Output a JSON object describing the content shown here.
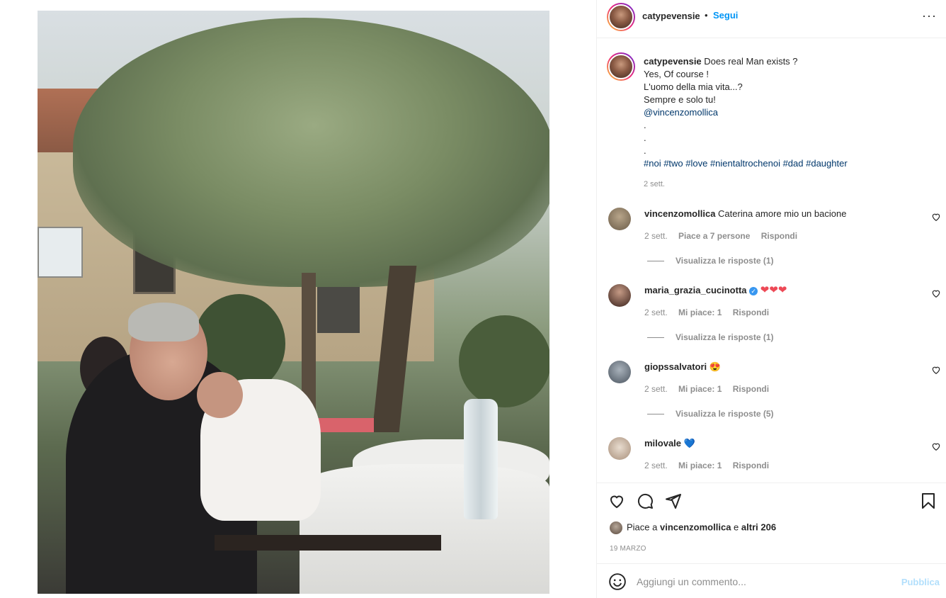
{
  "post": {
    "author": "catypevensie",
    "follow_label": "Segui",
    "separator": "•",
    "more_label": "···"
  },
  "caption": {
    "username": "catypevensie",
    "lines": [
      "Does real Man exists ?",
      "Yes, Of course !",
      "L'uomo della mia vita...?",
      "Sempre e solo tu!",
      "@vincenzomollica",
      ".",
      ".",
      ".",
      "#noi #two #love #nientaltrochenoi #dad #daughter"
    ],
    "time": "2 sett."
  },
  "comments": [
    {
      "username": "vincenzomollica",
      "text": "Caterina amore mio un bacione",
      "time": "2 sett.",
      "likes": "Piace a 7 persone",
      "reply": "Rispondi",
      "view_replies": "Visualizza le risposte (1)",
      "avatar_color": "#8a7a62"
    },
    {
      "username": "maria_grazia_cucinotta",
      "verified": true,
      "text": "❤❤❤",
      "time": "2 sett.",
      "likes": "Mi piace: 1",
      "reply": "Rispondi",
      "view_replies": "Visualizza le risposte (1)",
      "avatar_color": "#4a2f28"
    },
    {
      "username": "giopssalvatori",
      "text": "😍",
      "time": "2 sett.",
      "likes": "Mi piace: 1",
      "reply": "Rispondi",
      "view_replies": "Visualizza le risposte (5)",
      "avatar_color": "#6f7a86"
    },
    {
      "username": "milovale",
      "text": "💙",
      "time": "2 sett.",
      "likes": "Mi piace: 1",
      "reply": "Rispondi",
      "avatar_color": "#c9b8a8"
    }
  ],
  "likes": {
    "prefix": "Piace a",
    "user": "vincenzomollica",
    "suffix_and": "e",
    "others": "altri 206"
  },
  "date": "19 MARZO",
  "composer": {
    "placeholder": "Aggiungi un commento...",
    "publish_label": "Pubblica"
  },
  "colors": {
    "link_blue": "#0095f6",
    "hashtag_blue": "#00376b",
    "publish_disabled": "#b2dffc",
    "muted": "#8e8e8e"
  },
  "icons": [
    "heart-icon",
    "comment-icon",
    "share-icon",
    "bookmark-icon",
    "emoji-icon",
    "more-icon",
    "verified-icon"
  ]
}
